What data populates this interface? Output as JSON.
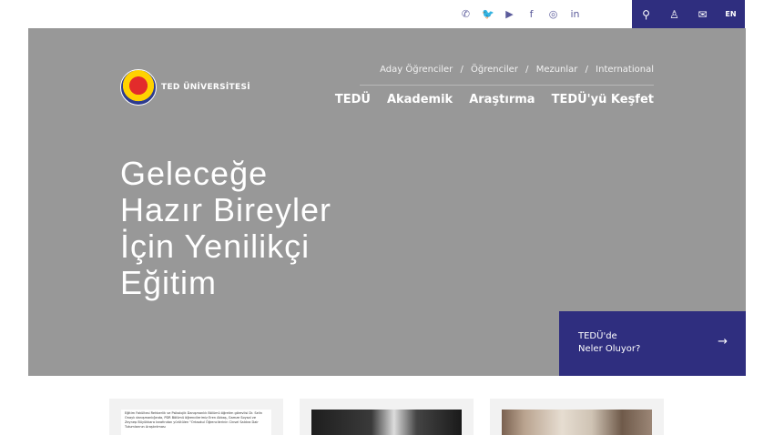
{
  "colors": {
    "brand": "#2f2e7f",
    "hero_bg": "#989898",
    "card_bg": "#f2f2f2"
  },
  "topbar": {
    "social_icons": [
      "whatsapp-icon",
      "twitter-icon",
      "youtube-icon",
      "facebook-icon",
      "instagram-icon",
      "linkedin-icon"
    ],
    "social_glyphs": [
      "✆",
      "🐦",
      "▶",
      "f",
      "◎",
      "in"
    ],
    "search_glyph": "⚲",
    "user_glyph": "♙",
    "mail_glyph": "✉",
    "lang_label": "EN"
  },
  "header": {
    "logo_text": "TED ÜNİVERSİTESİ",
    "subnav": [
      "Aday Öğrenciler",
      "Öğrenciler",
      "Mezunlar",
      "International"
    ],
    "subnav_sep": "/",
    "mainnav": [
      "TEDÜ",
      "Akademik",
      "Araştırma",
      "TEDÜ'yü Keşfet"
    ]
  },
  "hero": {
    "headline_lines": [
      "Geleceğe",
      "Hazır Bireyler",
      "İçin Yenilikçi",
      "Eğitim"
    ]
  },
  "news_box": {
    "line1": "TEDÜ'de",
    "line2": "Neler Oluyor?",
    "arrow": "→"
  },
  "cards": [
    {
      "text": "Eğitim Fakültesi Rehberlik ve Psikolojik Danışmanlık Bölümü öğretim görevlisi Dr. Selin Onaylı danışmanlığında, PDR Bölümü öğrencilerimiz Eren Akbaş, Gamze Soysal ve Zeynep Büyükkara tarafından yürütülen \"Ortaokul Öğrencilerinin Cinsel Saldıra Dair Tutumlarının Araştırılması"
    },
    {
      "text": ""
    },
    {
      "text": ""
    }
  ]
}
